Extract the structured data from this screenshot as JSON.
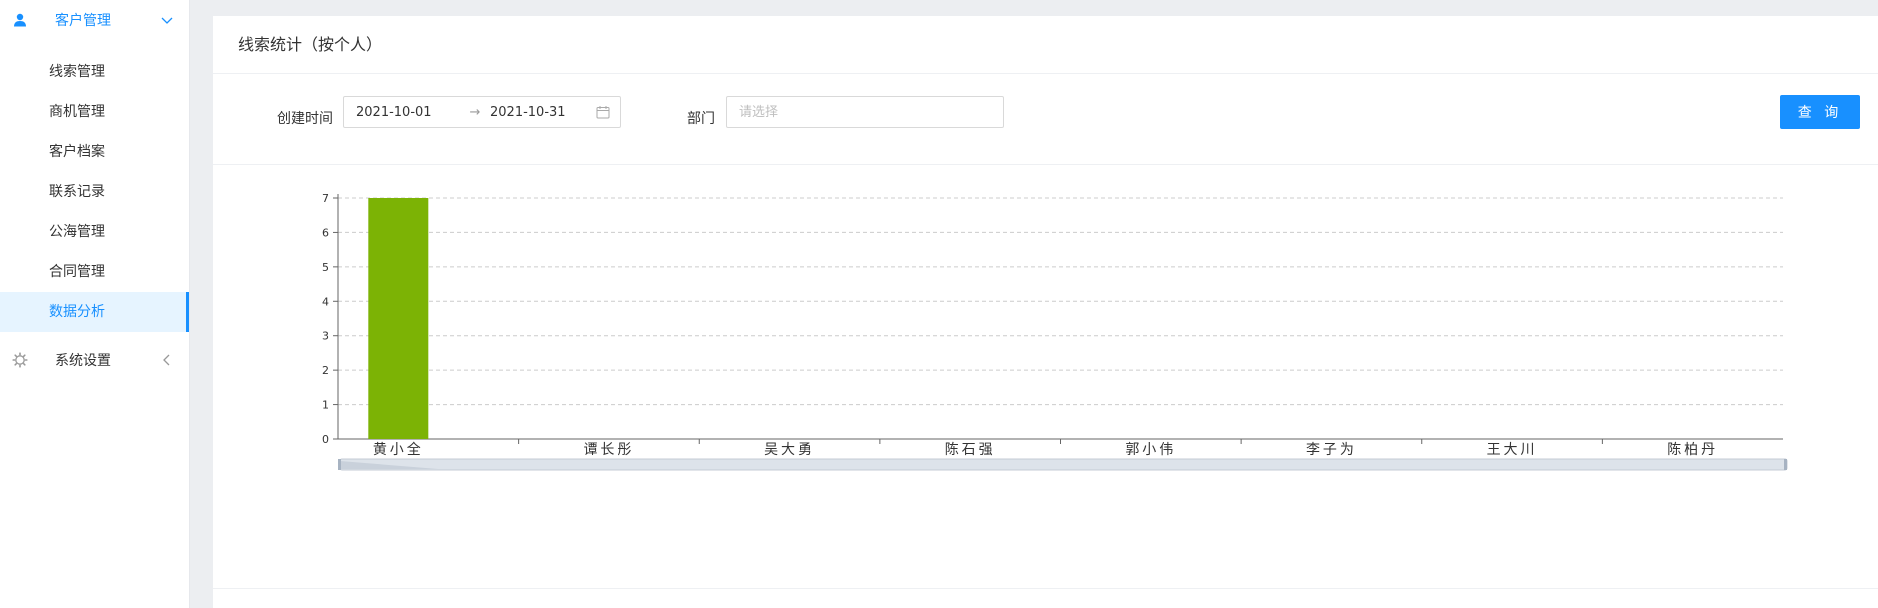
{
  "sidebar": {
    "customer_group": {
      "label": "客户管理"
    },
    "items": [
      {
        "label": "线索管理"
      },
      {
        "label": "商机管理"
      },
      {
        "label": "客户档案"
      },
      {
        "label": "联系记录"
      },
      {
        "label": "公海管理"
      },
      {
        "label": "合同管理"
      },
      {
        "label": "数据分析"
      }
    ],
    "active_index": 6,
    "system_group": {
      "label": "系统设置"
    }
  },
  "page": {
    "title": "线索统计（按个人）"
  },
  "filters": {
    "created_time_label": "创建时间",
    "start_date": "2021-10-01",
    "range_separator": "→",
    "end_date": "2021-10-31",
    "department_label": "部门",
    "department_placeholder": "请选择",
    "query_button": "查 询"
  },
  "colors": {
    "accent": "#1890ff",
    "bar": "#7cb305"
  },
  "chart_data": {
    "type": "bar",
    "categories": [
      "黄小全",
      "谭长彤",
      "吴大勇",
      "陈石强",
      "郭小伟",
      "李子为",
      "王大川",
      "陈柏丹"
    ],
    "values": [
      7,
      0,
      0,
      0,
      0,
      0,
      0,
      0
    ],
    "ylim": [
      0,
      7
    ],
    "yticks": [
      0,
      1,
      2,
      3,
      4,
      5,
      6,
      7
    ],
    "grid": true,
    "has_datazoom_slider": true
  }
}
